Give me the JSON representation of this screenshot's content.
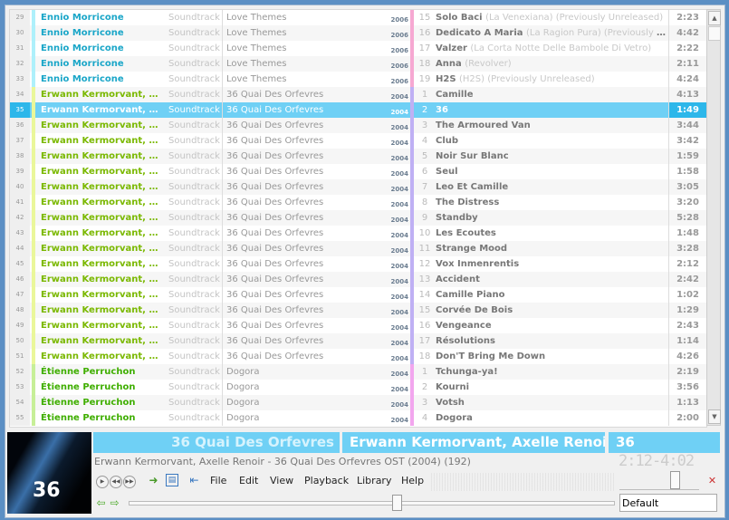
{
  "colors": {
    "selection": "#6fd0f5",
    "selection_dark": "#2db7ea",
    "artist_cyan": "#1aa6c8",
    "artist_green": "#7ab800",
    "artist_green2": "#3fae00",
    "bar_cyan": "#aef0fb",
    "bar_yellow": "#eaf79a",
    "bar_green": "#c7ef98",
    "bar_pink": "#f6a8d2",
    "bar_purple": "#bfb0f4",
    "bar_magenta": "#f2a6ee"
  },
  "playlist": {
    "selected_index": 6,
    "rows": [
      {
        "n": "29",
        "artist": "Ennio Morricone",
        "genre": "Soundtrack",
        "album": "Love Themes",
        "year": "2006",
        "tn": "15",
        "title": "Solo Baci",
        "extra": "(La Venexiana) (Previously Unreleased)",
        "time": "2:23",
        "g": 0
      },
      {
        "n": "30",
        "artist": "Ennio Morricone",
        "genre": "Soundtrack",
        "album": "Love Themes",
        "year": "2006",
        "tn": "16",
        "title": "Dedicato A Maria",
        "extra": "(La Ragion Pura) (Previously Unrelea...",
        "time": "4:42",
        "g": 0
      },
      {
        "n": "31",
        "artist": "Ennio Morricone",
        "genre": "Soundtrack",
        "album": "Love Themes",
        "year": "2006",
        "tn": "17",
        "title": "Valzer",
        "extra": "(La Corta Notte Delle Bambole Di Vetro)",
        "time": "2:22",
        "g": 0
      },
      {
        "n": "32",
        "artist": "Ennio Morricone",
        "genre": "Soundtrack",
        "album": "Love Themes",
        "year": "2006",
        "tn": "18",
        "title": "Anna",
        "extra": "(Revolver)",
        "time": "2:11",
        "g": 0
      },
      {
        "n": "33",
        "artist": "Ennio Morricone",
        "genre": "Soundtrack",
        "album": "Love Themes",
        "year": "2006",
        "tn": "19",
        "title": "H2S",
        "extra": "(H2S) (Previously Unreleased)",
        "time": "4:24",
        "g": 0
      },
      {
        "n": "34",
        "artist": "Erwann Kermorvant, Axelle...",
        "genre": "Soundtrack",
        "album": "36 Quai Des Orfevres",
        "year": "2004",
        "tn": "1",
        "title": "Camille",
        "extra": "",
        "time": "4:13",
        "g": 1
      },
      {
        "n": "35",
        "artist": "Erwann Kermorvant, Axelle...",
        "genre": "Soundtrack",
        "album": "36 Quai Des Orfevres",
        "year": "2004",
        "tn": "2",
        "title": "36",
        "extra": "",
        "time": "1:49",
        "g": 1
      },
      {
        "n": "36",
        "artist": "Erwann Kermorvant, Axelle...",
        "genre": "Soundtrack",
        "album": "36 Quai Des Orfevres",
        "year": "2004",
        "tn": "3",
        "title": "The Armoured Van",
        "extra": "",
        "time": "3:44",
        "g": 1
      },
      {
        "n": "37",
        "artist": "Erwann Kermorvant, Axelle...",
        "genre": "Soundtrack",
        "album": "36 Quai Des Orfevres",
        "year": "2004",
        "tn": "4",
        "title": "Club",
        "extra": "",
        "time": "3:42",
        "g": 1
      },
      {
        "n": "38",
        "artist": "Erwann Kermorvant, Axelle...",
        "genre": "Soundtrack",
        "album": "36 Quai Des Orfevres",
        "year": "2004",
        "tn": "5",
        "title": "Noir Sur Blanc",
        "extra": "",
        "time": "1:59",
        "g": 1
      },
      {
        "n": "39",
        "artist": "Erwann Kermorvant, Axelle...",
        "genre": "Soundtrack",
        "album": "36 Quai Des Orfevres",
        "year": "2004",
        "tn": "6",
        "title": "Seul",
        "extra": "",
        "time": "1:58",
        "g": 1
      },
      {
        "n": "40",
        "artist": "Erwann Kermorvant, Axelle...",
        "genre": "Soundtrack",
        "album": "36 Quai Des Orfevres",
        "year": "2004",
        "tn": "7",
        "title": "Leo Et Camille",
        "extra": "",
        "time": "3:05",
        "g": 1
      },
      {
        "n": "41",
        "artist": "Erwann Kermorvant, Axelle...",
        "genre": "Soundtrack",
        "album": "36 Quai Des Orfevres",
        "year": "2004",
        "tn": "8",
        "title": "The Distress",
        "extra": "",
        "time": "3:20",
        "g": 1
      },
      {
        "n": "42",
        "artist": "Erwann Kermorvant, Axelle...",
        "genre": "Soundtrack",
        "album": "36 Quai Des Orfevres",
        "year": "2004",
        "tn": "9",
        "title": "Standby",
        "extra": "",
        "time": "5:28",
        "g": 1
      },
      {
        "n": "43",
        "artist": "Erwann Kermorvant, Axelle...",
        "genre": "Soundtrack",
        "album": "36 Quai Des Orfevres",
        "year": "2004",
        "tn": "10",
        "title": "Les Ecoutes",
        "extra": "",
        "time": "1:48",
        "g": 1
      },
      {
        "n": "44",
        "artist": "Erwann Kermorvant, Axelle...",
        "genre": "Soundtrack",
        "album": "36 Quai Des Orfevres",
        "year": "2004",
        "tn": "11",
        "title": "Strange Mood",
        "extra": "",
        "time": "3:28",
        "g": 1
      },
      {
        "n": "45",
        "artist": "Erwann Kermorvant, Axelle...",
        "genre": "Soundtrack",
        "album": "36 Quai Des Orfevres",
        "year": "2004",
        "tn": "12",
        "title": "Vox Inmenrentis",
        "extra": "",
        "time": "2:12",
        "g": 1
      },
      {
        "n": "46",
        "artist": "Erwann Kermorvant, Axelle...",
        "genre": "Soundtrack",
        "album": "36 Quai Des Orfevres",
        "year": "2004",
        "tn": "13",
        "title": "Accident",
        "extra": "",
        "time": "2:42",
        "g": 1
      },
      {
        "n": "47",
        "artist": "Erwann Kermorvant, Axelle...",
        "genre": "Soundtrack",
        "album": "36 Quai Des Orfevres",
        "year": "2004",
        "tn": "14",
        "title": "Camille Piano",
        "extra": "",
        "time": "1:02",
        "g": 1
      },
      {
        "n": "48",
        "artist": "Erwann Kermorvant, Axelle...",
        "genre": "Soundtrack",
        "album": "36 Quai Des Orfevres",
        "year": "2004",
        "tn": "15",
        "title": "Corvée De Bois",
        "extra": "",
        "time": "1:29",
        "g": 1
      },
      {
        "n": "49",
        "artist": "Erwann Kermorvant, Axelle...",
        "genre": "Soundtrack",
        "album": "36 Quai Des Orfevres",
        "year": "2004",
        "tn": "16",
        "title": "Vengeance",
        "extra": "",
        "time": "2:43",
        "g": 1
      },
      {
        "n": "50",
        "artist": "Erwann Kermorvant, Axelle...",
        "genre": "Soundtrack",
        "album": "36 Quai Des Orfevres",
        "year": "2004",
        "tn": "17",
        "title": "Résolutions",
        "extra": "",
        "time": "1:14",
        "g": 1
      },
      {
        "n": "51",
        "artist": "Erwann Kermorvant, Axelle...",
        "genre": "Soundtrack",
        "album": "36 Quai Des Orfevres",
        "year": "2004",
        "tn": "18",
        "title": "Don'T Bring Me Down",
        "extra": "",
        "time": "4:26",
        "g": 1
      },
      {
        "n": "52",
        "artist": "Étienne Perruchon",
        "genre": "Soundtrack",
        "album": "Dogora",
        "year": "2004",
        "tn": "1",
        "title": "Tchunga-ya!",
        "extra": "",
        "time": "2:19",
        "g": 2
      },
      {
        "n": "53",
        "artist": "Étienne Perruchon",
        "genre": "Soundtrack",
        "album": "Dogora",
        "year": "2004",
        "tn": "2",
        "title": "Kourni",
        "extra": "",
        "time": "3:56",
        "g": 2
      },
      {
        "n": "54",
        "artist": "Étienne Perruchon",
        "genre": "Soundtrack",
        "album": "Dogora",
        "year": "2004",
        "tn": "3",
        "title": "Votsh",
        "extra": "",
        "time": "1:13",
        "g": 2
      },
      {
        "n": "55",
        "artist": "Étienne Perruchon",
        "genre": "Soundtrack",
        "album": "Dogora",
        "year": "2004",
        "tn": "4",
        "title": "Dogora",
        "extra": "",
        "time": "2:00",
        "g": 2
      }
    ]
  },
  "now_playing": {
    "album": "36 Quai Des Orfevres",
    "artist": "Erwann Kermorvant, Axelle Renoir",
    "title": "36",
    "info": "Erwann Kermorvant, Axelle Renoir - 36 Quai Des Orfevres OST (2004) (192)",
    "clock": "2:12-4:02",
    "art_text": "36",
    "seek_fraction": 0.55,
    "volume_fraction": 0.68
  },
  "menu": [
    "File",
    "Edit",
    "View",
    "Playback",
    "Library",
    "Help"
  ],
  "dsp_preset": "Default"
}
